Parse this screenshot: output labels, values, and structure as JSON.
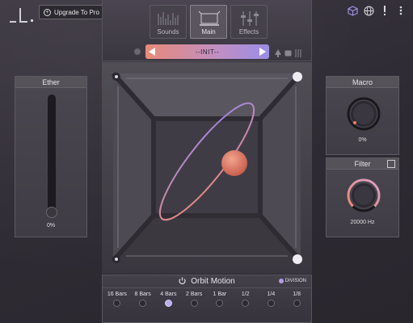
{
  "header": {
    "upgrade_label": "Upgrade To Pro",
    "icons": [
      "cube-icon",
      "globe-icon",
      "alert-icon",
      "menu-icon"
    ]
  },
  "tabs": [
    {
      "label": "Sounds",
      "active": false
    },
    {
      "label": "Main",
      "active": true
    },
    {
      "label": "Effects",
      "active": false
    }
  ],
  "preset": {
    "name": "--INIT--",
    "gradient": [
      "#e88a78",
      "#9b8de6"
    ]
  },
  "ether": {
    "title": "Ether",
    "value": "0%"
  },
  "macro": {
    "title": "Macro",
    "value": "0%"
  },
  "filter": {
    "title": "Filter",
    "value": "20000 Hz"
  },
  "orbit": {
    "title": "Orbit Motion",
    "division_label": "DIVISION",
    "bars": [
      {
        "label": "16 Bars",
        "selected": false
      },
      {
        "label": "8 Bars",
        "selected": false
      },
      {
        "label": "4 Bars",
        "selected": true
      },
      {
        "label": "2 Bars",
        "selected": false
      },
      {
        "label": "1 Bar",
        "selected": false
      },
      {
        "label": "1/2",
        "selected": false
      },
      {
        "label": "1/4",
        "selected": false
      },
      {
        "label": "1/8",
        "selected": false
      }
    ]
  },
  "colors": {
    "accent_orange": "#e8806a",
    "accent_purple": "#a18de8",
    "sphere": "#e0836e"
  }
}
